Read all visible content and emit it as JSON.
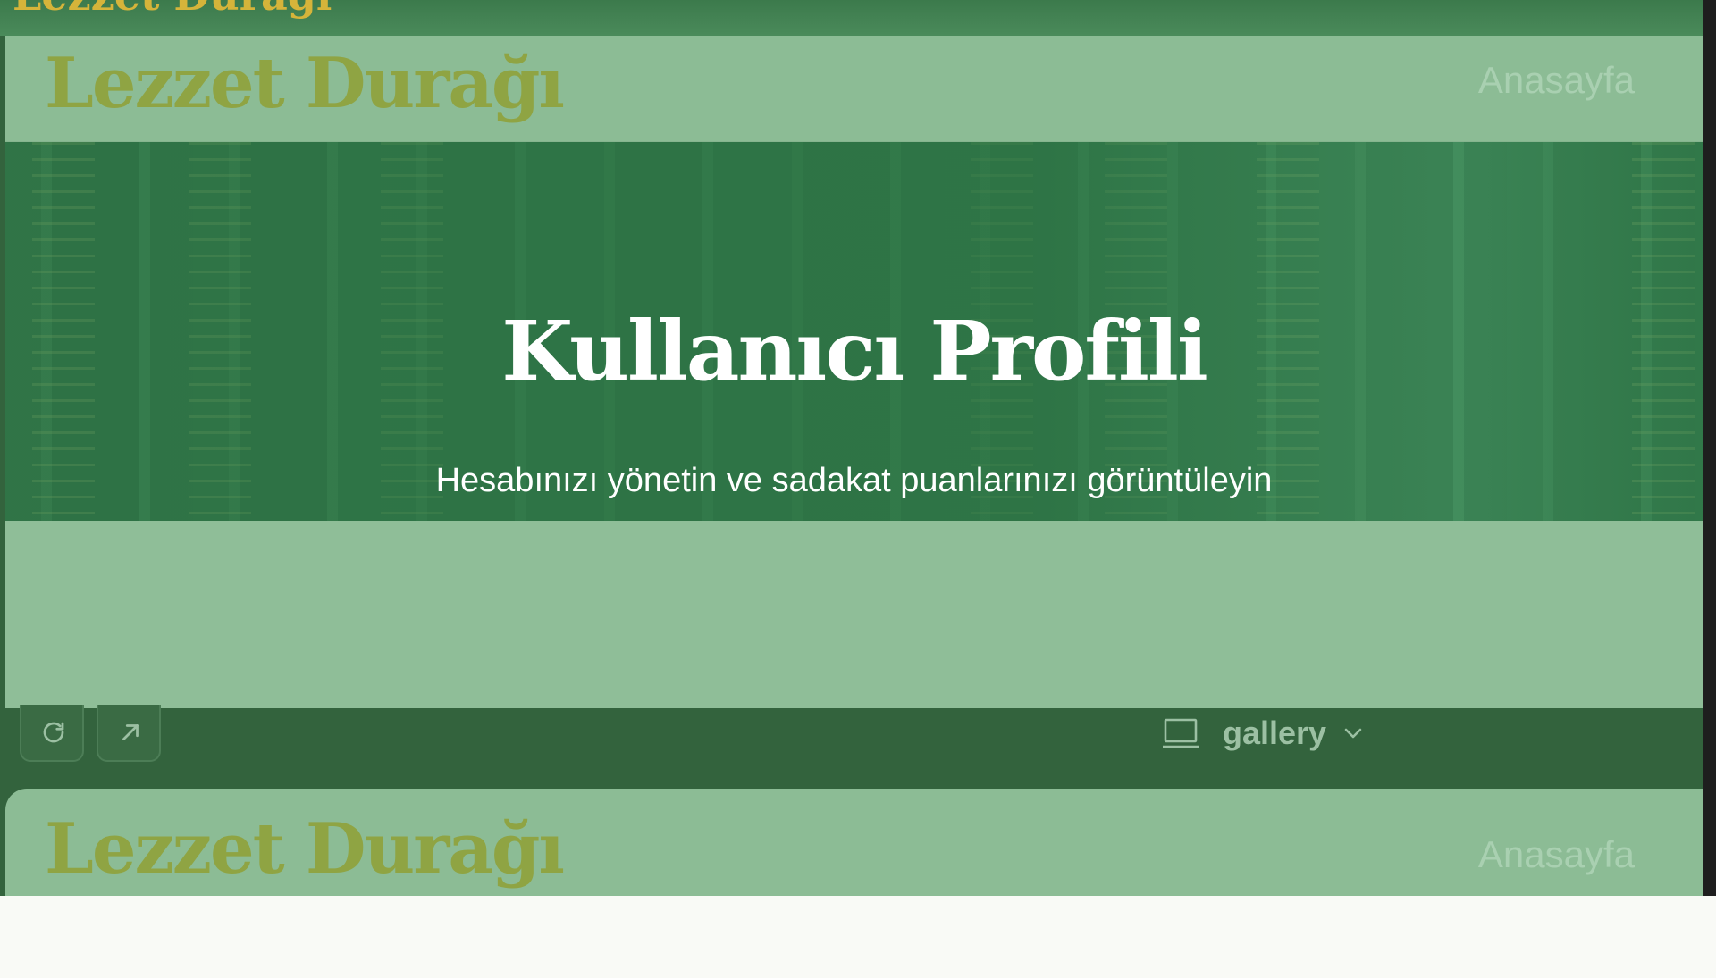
{
  "top_strip": {
    "logo_text": "Lezzet Durağı"
  },
  "site": {
    "logo_text": "Lezzet Durağı",
    "nav_home": "Anasayfa"
  },
  "hero": {
    "title": "Kullanıcı Profili",
    "subtitle": "Hesabınızı yönetin ve sadakat puanlarınızı görüntüleyin"
  },
  "toolbar": {
    "refresh_icon": "refresh-icon",
    "open_external_icon": "arrow-up-right-icon",
    "device_icon": "laptop-icon",
    "view_select_value": "gallery",
    "view_select_icon": "chevron-down-icon"
  },
  "preview_repeat": {
    "logo_text": "Lezzet Durağı",
    "nav_home": "Anasayfa"
  },
  "colors": {
    "logo": "#8fa443",
    "top_logo": "#d5b43a",
    "hero_text": "#ffffff",
    "toolbar_bg": "#33633d",
    "panel_bg": "#8fbe98"
  }
}
